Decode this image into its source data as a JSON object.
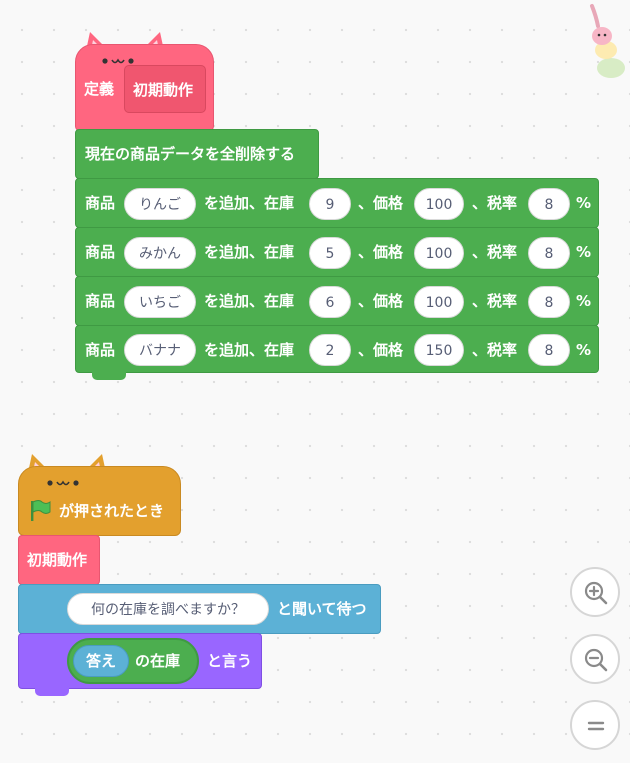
{
  "script1": {
    "define_label": "定義",
    "define_name": "初期動作",
    "clear_label": "現在の商品データを全削除する",
    "product_label": "商品",
    "add_label": "を追加、在庫",
    "price_label": "、価格",
    "tax_label": "、税率",
    "percent": "%",
    "products": [
      {
        "name": "りんご",
        "stock": "9",
        "price": "100",
        "tax": "8"
      },
      {
        "name": "みかん",
        "stock": "5",
        "price": "100",
        "tax": "8"
      },
      {
        "name": "いちご",
        "stock": "6",
        "price": "100",
        "tax": "8"
      },
      {
        "name": "バナナ",
        "stock": "2",
        "price": "150",
        "tax": "8"
      }
    ]
  },
  "script2": {
    "hat_label": "が押されたとき",
    "call_label": "初期動作",
    "ask_question": "何の在庫を調べますか？",
    "ask_suffix": "と聞いて待つ",
    "answer_label": "答え",
    "stock_of_label": "の在庫",
    "say_label": "と言う"
  },
  "colors": {
    "define": "#ff6680",
    "data": "#4cae4f",
    "event": "#e3a02e",
    "sensing": "#5cb1d6",
    "looks": "#9966ff"
  },
  "icons": {
    "flag": "green-flag-icon",
    "zoom_in": "zoom-in-icon",
    "zoom_out": "zoom-out-icon",
    "zoom_reset": "zoom-reset-icon"
  }
}
